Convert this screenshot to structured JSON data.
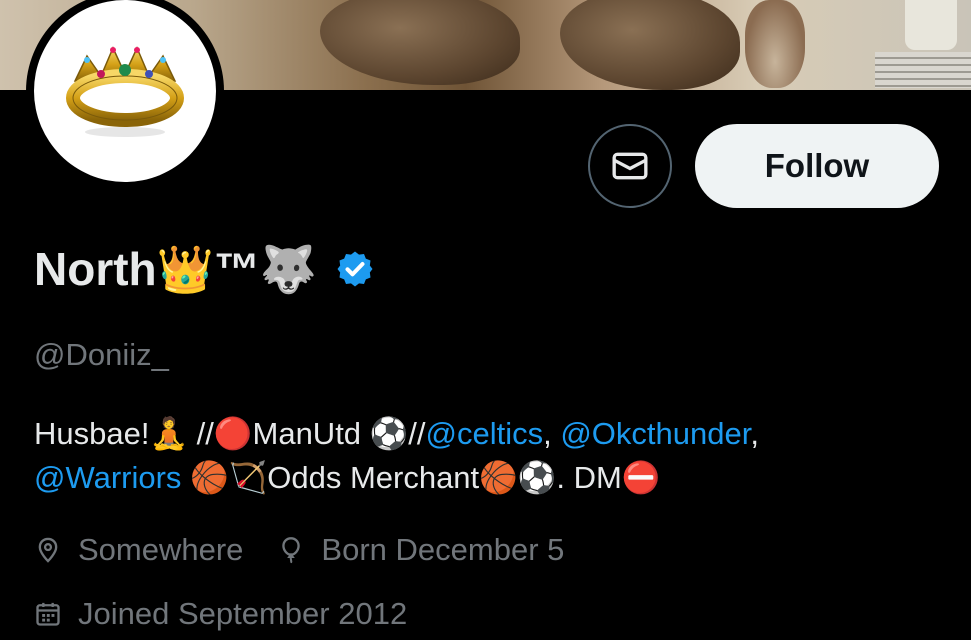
{
  "profile": {
    "display_name": "North👑™🐺",
    "handle": "@Doniiz_",
    "verified": true,
    "bio": {
      "line1_text1": "Husbae!🧘 //🔴ManUtd ⚽//",
      "mention1": "@celtics",
      "sep1": ", ",
      "mention2": "@Okcthunder",
      "sep2": ",",
      "mention3": "@Warriors",
      "line2_text": " 🏀🏹Odds Merchant🏀⚽. DM⛔"
    },
    "location": "Somewhere",
    "birthday": "Born December 5",
    "joined": "Joined September 2012"
  },
  "actions": {
    "follow_label": "Follow"
  },
  "icons": {
    "message": "envelope-icon",
    "verified": "verified-badge-icon",
    "location": "location-pin-icon",
    "birthday": "balloon-icon",
    "joined": "calendar-icon"
  },
  "colors": {
    "background": "#000000",
    "text": "#e7e9ea",
    "secondary": "#71767b",
    "link": "#1d9bf0",
    "follow_bg": "#eff3f4"
  }
}
